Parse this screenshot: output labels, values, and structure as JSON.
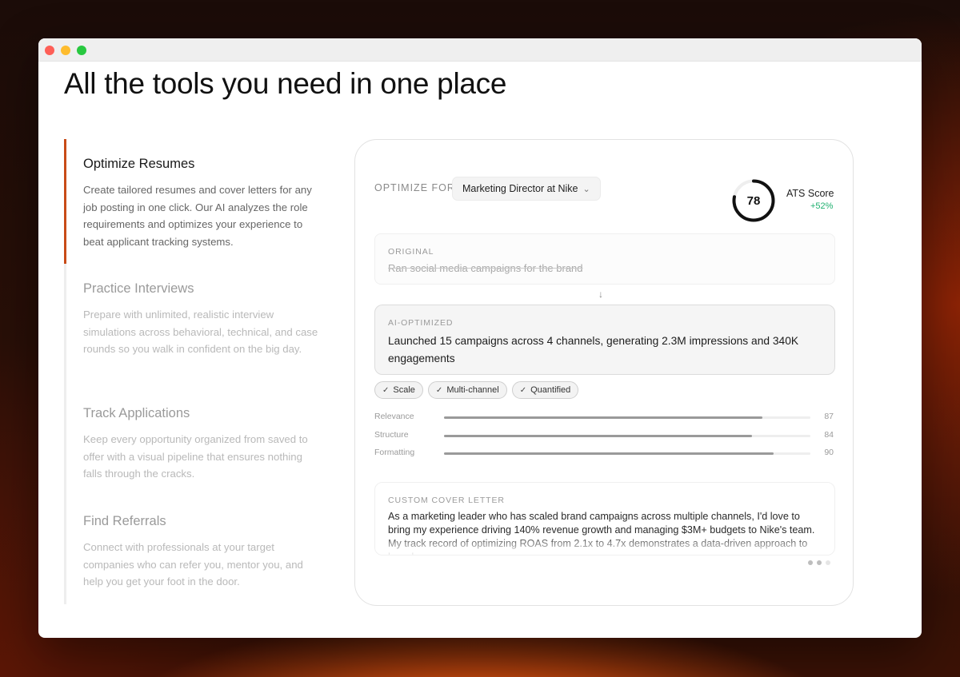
{
  "page": {
    "headline": "All the tools you need in one place"
  },
  "features": [
    {
      "title": "Optimize Resumes",
      "description": "Create tailored resumes and cover letters for any job posting in one click. Our AI analyzes the role requirements and optimizes your experience to beat applicant tracking systems.",
      "active": true
    },
    {
      "title": "Practice Interviews",
      "description": "Prepare with unlimited, realistic interview simulations across behavioral, technical, and case rounds so you walk in confident on the big day.",
      "active": false
    },
    {
      "title": "Track Applications",
      "description": "Keep every opportunity organized from saved to offer with a visual pipeline that ensures nothing falls through the cracks.",
      "active": false
    },
    {
      "title": "Find Referrals",
      "description": "Connect with professionals at your target companies who can refer you, mentor you, and help you get your foot in the door.",
      "active": false
    }
  ],
  "card": {
    "optimize_label": "OPTIMIZE FOR",
    "role_selected": "Marketing Director at Nike",
    "ats": {
      "score": "78",
      "score_fraction": 0.78,
      "label": "ATS Score",
      "delta": "+52%"
    },
    "original": {
      "label": "ORIGINAL",
      "text": "Ran social media campaigns for the brand"
    },
    "ai_optimized": {
      "label": "AI-OPTIMIZED",
      "text": "Launched 15 campaigns across 4 channels, generating 2.3M impressions and 340K engagements"
    },
    "tags": [
      "Scale",
      "Multi-channel",
      "Quantified"
    ],
    "metrics": [
      {
        "label": "Relevance",
        "value": 87
      },
      {
        "label": "Structure",
        "value": 84
      },
      {
        "label": "Formatting",
        "value": 90
      }
    ],
    "cover_letter": {
      "label": "CUSTOM COVER LETTER",
      "text": "As a marketing leader who has scaled brand campaigns across multiple channels, I'd love to bring my experience driving 140% revenue growth and managing $3M+ budgets to Nike's team. My track record of optimizing ROAS from 2.1x to 4.7x demonstrates a data-driven approach to brand"
    },
    "pager": {
      "total": 3,
      "current": 2
    }
  },
  "colors": {
    "accent": "#c84b17",
    "positive": "#20b070",
    "ring": "#111111"
  }
}
